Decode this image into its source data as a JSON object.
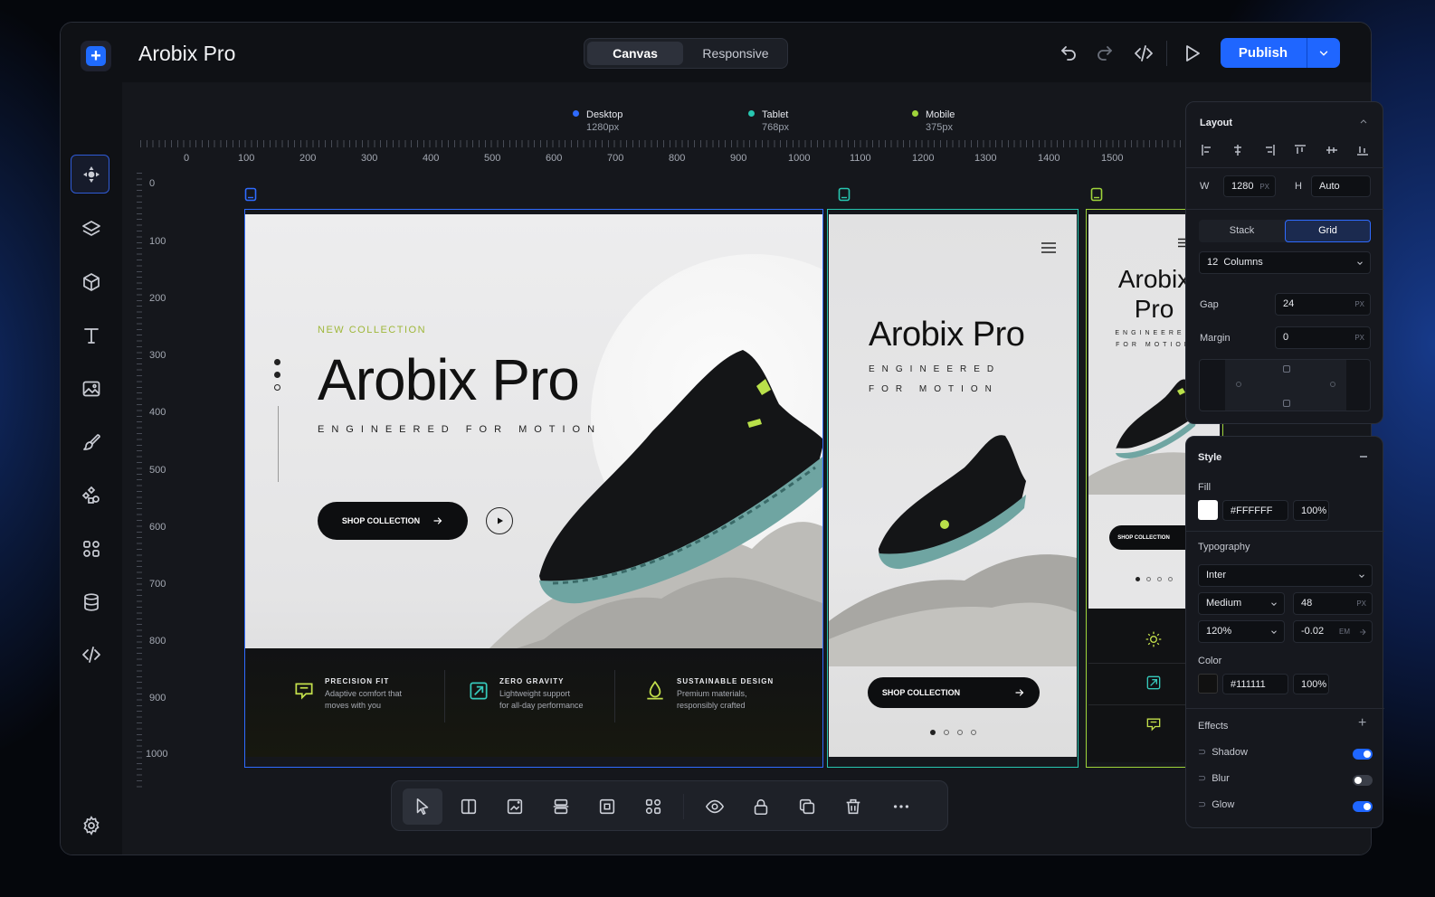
{
  "app": {
    "title": "Arobix Pro"
  },
  "view_tabs": [
    {
      "label": "Canvas",
      "active": true
    },
    {
      "label": "Responsive",
      "active": false
    }
  ],
  "toolbar": {
    "publish_label": "Publish",
    "icons": [
      "undo-icon",
      "redo-icon",
      "code-icon",
      "play-icon"
    ]
  },
  "sidebar": {
    "icons": [
      "move-icon",
      "layers-icon",
      "cube-icon",
      "text-icon",
      "image-icon",
      "brush-icon",
      "components-icon",
      "widgets-icon",
      "database-icon",
      "code-icon"
    ],
    "bottom_icons": [
      "gear-icon",
      "help-icon"
    ]
  },
  "breakpoints": [
    {
      "name": "Desktop",
      "size": "1280px",
      "color": "#2f6bff"
    },
    {
      "name": "Tablet",
      "size": "768px",
      "color": "#27c6b0"
    },
    {
      "name": "Mobile",
      "size": "375px",
      "color": "#9fd43a"
    }
  ],
  "ruler": {
    "h": [
      "0",
      "100",
      "200",
      "300",
      "400",
      "500",
      "600",
      "700",
      "800",
      "900",
      "1000",
      "1100",
      "1200",
      "1300",
      "1400",
      "1500"
    ],
    "v": [
      "0",
      "100",
      "200",
      "300",
      "400",
      "500",
      "600",
      "700",
      "800",
      "900",
      "1000"
    ]
  },
  "hero": {
    "eyebrow": "NEW COLLECTION",
    "title": "Arobix Pro",
    "tagline": "ENGINEERED FOR MOTION",
    "cta": "SHOP COLLECTION",
    "features": [
      {
        "title": "PRECISION FIT",
        "line1": "Adaptive comfort that",
        "line2": "moves with you"
      },
      {
        "title": "ZERO GRAVITY",
        "line1": "Lightweight support",
        "line2": "for all-day performance"
      },
      {
        "title": "SUSTAINABLE DESIGN",
        "line1": "Premium materials,",
        "line2": "responsibly crafted"
      }
    ]
  },
  "tablet": {
    "title": "Arobix Pro",
    "tagline_1": "ENGINEERED",
    "tagline_2": "FOR MOTION",
    "cta": "SHOP COLLECTION"
  },
  "mobile": {
    "title_1": "Arobix",
    "title_2": "Pro",
    "tagline_1": "ENGINEERED",
    "tagline_2": "FOR MOTION",
    "cta": "SHOP COLLECTION"
  },
  "layout_panel": {
    "title": "Layout",
    "w_label": "W",
    "w_value": "1280",
    "w_unit": "PX",
    "h_label": "H",
    "h_value": "Auto",
    "mode_tabs": [
      {
        "label": "Stack",
        "active": false
      },
      {
        "label": "Grid",
        "active": true
      }
    ],
    "columns": "12  Columns",
    "gap_label": "Gap",
    "gap_value": "24",
    "gap_unit": "PX",
    "margin_label": "Margin",
    "margin_value": "0",
    "margin_unit": "PX"
  },
  "style_panel": {
    "title": "Style",
    "fill_label": "Fill",
    "fill_hex": "#FFFFFF",
    "fill_opacity": "100%",
    "typography_label": "Typography",
    "font": "Inter",
    "weight": "Medium",
    "size": "48",
    "size_unit": "PX",
    "line_height": "120%",
    "letter_spacing": "-0.02",
    "letter_unit": "EM",
    "color_label": "Color",
    "color_hex": "#111111",
    "color_opacity": "100%",
    "effects_label": "Effects",
    "effects": [
      {
        "label": "Shadow",
        "on": true
      },
      {
        "label": "Blur",
        "on": false
      },
      {
        "label": "Glow",
        "on": true
      }
    ]
  },
  "bottom_tools": [
    "cursor-icon",
    "split-layout-icon",
    "add-image-icon",
    "align-center-icon",
    "frame-icon",
    "grid-icon",
    "eye-icon",
    "lock-icon",
    "duplicate-icon",
    "trash-icon",
    "more-icon"
  ]
}
